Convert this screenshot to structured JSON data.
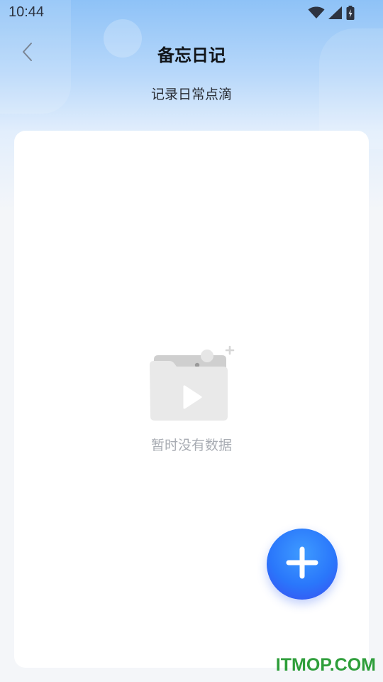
{
  "status_bar": {
    "time": "10:44",
    "icons": [
      "wifi-icon",
      "signal-icon",
      "battery-charging-icon"
    ]
  },
  "header": {
    "back_icon": "chevron-left-icon",
    "title": "备忘日记",
    "subtitle": "记录日常点滴"
  },
  "content": {
    "empty_state": {
      "icon": "empty-folder-video-icon",
      "text": "暂时没有数据"
    }
  },
  "fab": {
    "icon": "plus-icon"
  },
  "colors": {
    "header_gradient_top": "#8ec2f7",
    "page_background": "#f4f6f9",
    "card_background": "#ffffff",
    "fab_blue": "#2a77fb",
    "empty_text": "#a8acb3"
  },
  "watermark": "ITMOP.COM"
}
